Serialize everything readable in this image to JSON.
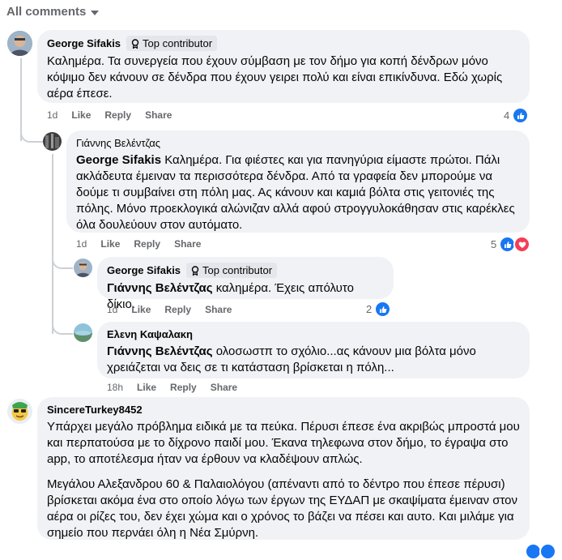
{
  "filter": {
    "label": "All comments"
  },
  "comments": [
    {
      "author": "George Sifakis",
      "badge": "Top contributor",
      "text": "Καλημέρα. Τα συνεργεία που έχουν σύμβαση με τον δήμο για κοπή δένδρων μόνο κόψιμο δεν κάνουν σε δένδρα που έχουν γειρει πολύ και είναι επικίνδυνα. Εδώ χωρίς αέρα έπεσε.",
      "time": "1d",
      "like": "Like",
      "reply": "Reply",
      "share": "Share",
      "reaction_count": "4"
    },
    {
      "author": "Γιάννης Βελέντζας",
      "mention": "George Sifakis",
      "text": "Καλημέρα. Για φιέστες και για πανηγύρια είμαστε πρώτοι. Πάλι ακλάδευτα έμειναν τα περισσότερα δένδρα. Από τα γραφεία δεν μπορούμε να δούμε τι συμβαίνει στη πόλη μας. Ας κάνουν και καμιά βόλτα στις γειτονιές της πόλης. Μόνο προεκλογικά αλώνιζαν αλλά αφού στρογγυλοκάθησαν στις καρέκλες όλα δουλεύουν στον αυτόματο.",
      "time": "1d",
      "like": "Like",
      "reply": "Reply",
      "share": "Share",
      "reaction_count": "5"
    },
    {
      "author": "George Sifakis",
      "badge": "Top contributor",
      "mention": "Γιάννης Βελέντζας",
      "text": "καλημέρα. Έχεις απόλυτο δίκιο.",
      "time": "1d",
      "like": "Like",
      "reply": "Reply",
      "share": "Share",
      "reaction_count": "2"
    },
    {
      "author": "Ελενη Καψαλακη",
      "mention": "Γιάννης Βελέντζας",
      "text": "ολοσωστπ το σχόλιο...ας κάνουν μια βόλτα μόνο χρειάζεται να δεις σε τι κατάσταση βρίσκεται η πόλη...",
      "time": "18h",
      "like": "Like",
      "reply": "Reply",
      "share": "Share"
    },
    {
      "author": "SincereTurkey8452",
      "para1": "Υπάρχει μεγάλο πρόβλημα ειδικά με τα πεύκα. Πέρυσι έπεσε ένα ακριβώς μπροστά μου και περπατούσα με το δίχρονο παιδί μου. Έκανα τηλεφωνα στον δήμο, το έγραψα στο app, το αποτέλεσμα ήταν να έρθουν να κλαδέψουν απλώς.",
      "para2": "Μεγάλου Αλεξανδρου 60 & Παλαιολόγου (απέναντι από το δέντρο που έπεσε πέρυσι) βρίσκεται ακόμα ένα στο οποίο λόγω των έργων της ΕΥΔΑΠ με σκαψίματα έμειναν στον αέρα οι ρίζες του, δεν έχει χώμα και ο χρόνος το βάζει να πέσει και αυτο. Και μιλάμε για σημείο που περνάει όλη η Νέα Σμύρνη."
    }
  ],
  "colors": {
    "like_blue": "#1877f2",
    "love_red": "#f33e58",
    "bubble": "#f0f2f5",
    "meta_gray": "#65676b"
  }
}
